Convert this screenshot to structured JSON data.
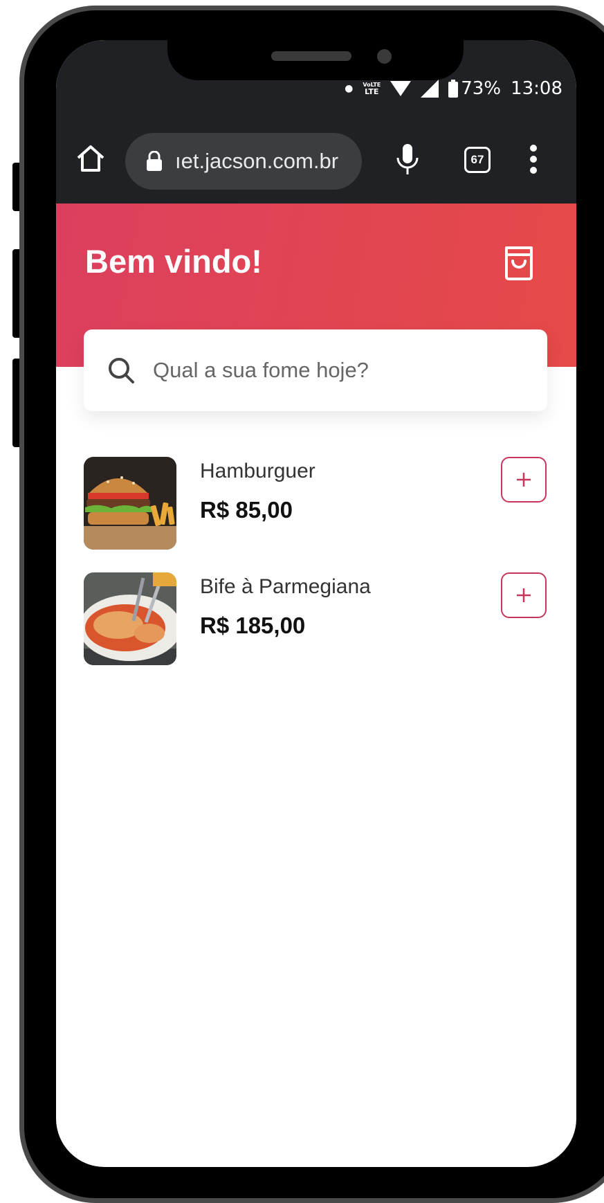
{
  "status_bar": {
    "network": "LTE",
    "network_top": "VoLTE",
    "battery": "73%",
    "time": "13:08"
  },
  "browser": {
    "url": "ıet.jacson.com.br",
    "tab_count": "67"
  },
  "header": {
    "title": "Bem vindo!"
  },
  "search": {
    "placeholder": "Qual a sua fome hoje?"
  },
  "products": [
    {
      "name": "Hamburguer",
      "price": "R$ 85,00",
      "image": "burger-image"
    },
    {
      "name": "Bife à Parmegiana",
      "price": "R$ 185,00",
      "image": "parmigiana-image"
    }
  ],
  "colors": {
    "accent": "#dc3f5e",
    "accent_end": "#e64a48",
    "browser_bar": "#202124",
    "add_border": "#c7365a"
  },
  "icons": [
    "home-icon",
    "lock-icon",
    "mic-icon",
    "tabs-icon",
    "menu-icon",
    "bag-icon",
    "search-icon",
    "plus-icon"
  ]
}
